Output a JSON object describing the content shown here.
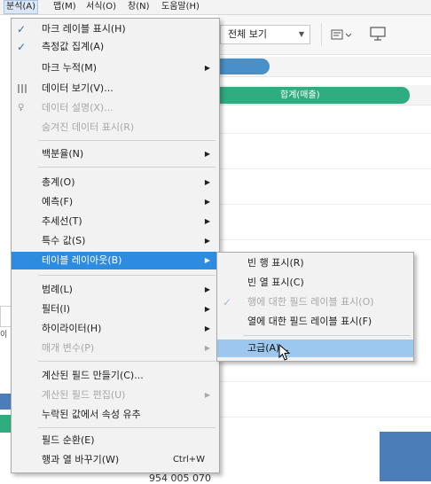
{
  "menubar": {
    "items": [
      {
        "label": "분석(A)",
        "active": true
      },
      {
        "label": "맵(M)",
        "active": false
      },
      {
        "label": "서식(O)",
        "active": false
      },
      {
        "label": "창(N)",
        "active": false
      },
      {
        "label": "도움말(H)",
        "active": false
      }
    ]
  },
  "toolbar": {
    "view_select_value": "전체 보기",
    "shelf_pill_label": "합계(매출)"
  },
  "analysis_menu": {
    "items": {
      "show_mark_labels": {
        "label": "마크 레이블 표시(H)",
        "checked": true
      },
      "aggregate_measures": {
        "label": "측정값 집계(A)",
        "checked": true
      },
      "stack_marks": {
        "label": "마크 누적(M)"
      },
      "view_data": {
        "label": "데이터 보기(V)..."
      },
      "describe_data": {
        "label": "데이터 설명(X)...",
        "disabled": true
      },
      "show_hidden_data": {
        "label": "숨겨진 데이터 표시(R)",
        "disabled": true
      },
      "percentage_of": {
        "label": "백분율(N)"
      },
      "totals": {
        "label": "총계(O)"
      },
      "forecast": {
        "label": "예측(F)"
      },
      "trend_lines": {
        "label": "추세선(T)"
      },
      "special_values": {
        "label": "특수 값(S)"
      },
      "table_layout": {
        "label": "테이블 레이아웃(B)",
        "highlighted": true
      },
      "legends": {
        "label": "범례(L)"
      },
      "filters": {
        "label": "필터(I)"
      },
      "highlighters": {
        "label": "하이라이터(H)"
      },
      "parameters": {
        "label": "매개 변수(P)",
        "disabled": true
      },
      "create_calculated_field": {
        "label": "계산된 필드 만들기(C)..."
      },
      "edit_calculated_field": {
        "label": "계산된 필드 편집(U)",
        "disabled": true
      },
      "infer_missing": {
        "label": "누락된 값에서 속성 유추"
      },
      "cycle_fields": {
        "label": "필드 순환(E)"
      },
      "swap_rows_columns": {
        "label": "행과 열 바꾸기(W)",
        "shortcut": "Ctrl+W"
      }
    }
  },
  "table_layout_submenu": {
    "items": {
      "show_empty_rows": {
        "label": "빈 행 표시(R)"
      },
      "show_empty_columns": {
        "label": "빈 열 표시(C)"
      },
      "show_row_field_labels": {
        "label": "행에 대한 필드 레이블 표시(O)",
        "checked": true,
        "disabled": true
      },
      "show_column_field_labels": {
        "label": "열에 대한 필드 레이블 표시(F)"
      },
      "advanced": {
        "label": "고급(A)...",
        "hovered": true
      }
    }
  },
  "background": {
    "left_fragment_label": "이",
    "bottom_number": "954 005 070"
  },
  "colors": {
    "highlight": "#2e8ce0",
    "hover": "#9cc7ee",
    "pill_blue": "#4a90c8",
    "pill_green": "#2fad80",
    "bar": "#4b7db8"
  }
}
